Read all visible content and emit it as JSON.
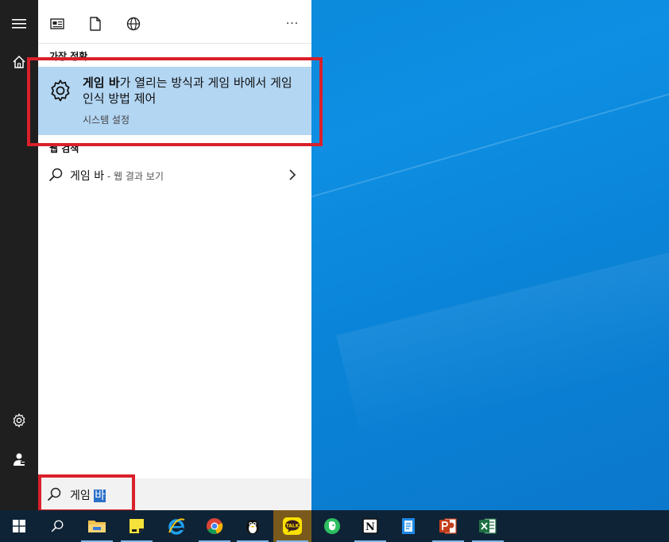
{
  "start_menu": {
    "toolbar": {
      "icons": [
        "news-icon",
        "document-icon",
        "globe-icon"
      ],
      "more_label": "···"
    },
    "best_match": {
      "section_label": "가장 정확",
      "title_bold": "게임 바",
      "title_rest": "가 열리는 방식과 게임 바에서 게임 인식 방법 제어",
      "subtitle": "시스템 설정"
    },
    "web_search": {
      "section_label": "웹 검색",
      "query": "게임 바",
      "hint": " - 웹 결과 보기"
    },
    "search_box": {
      "text_prefix": "게임 ",
      "text_selected": "바"
    }
  },
  "taskbar": {
    "items": [
      "start-icon",
      "search-icon",
      "file-explorer-icon",
      "sticky-notes-icon",
      "internet-explorer-icon",
      "chrome-icon",
      "penguin-app-icon",
      "kakaotalk-icon",
      "evernote-icon",
      "notion-icon",
      "app-icon",
      "powerpoint-icon",
      "excel-icon"
    ],
    "kakaotalk_label": "TALK",
    "notion_label": "N"
  },
  "colors": {
    "highlight": "#b3d6f3",
    "annotation_red": "#d9202a",
    "taskbar": "#0f2336"
  }
}
